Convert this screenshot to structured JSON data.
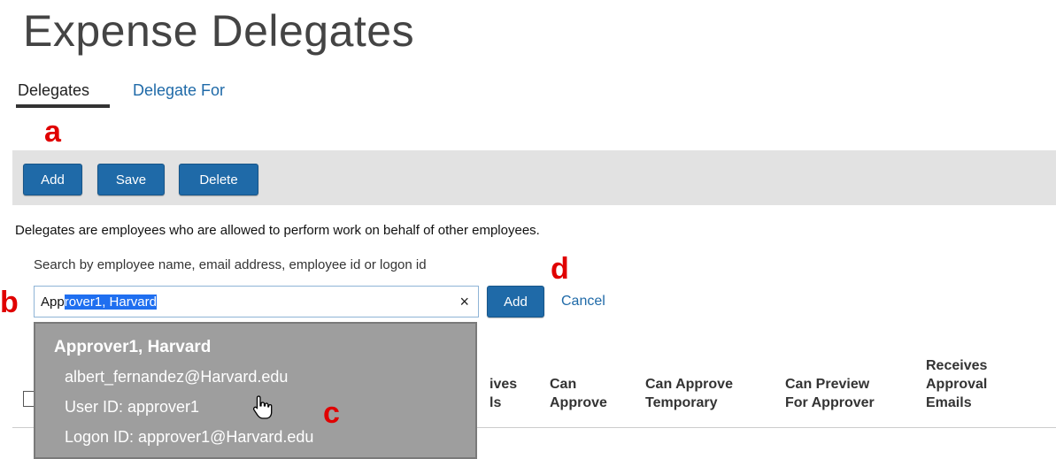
{
  "page": {
    "title": "Expense Delegates"
  },
  "tabs": [
    {
      "label": "Delegates",
      "active": true
    },
    {
      "label": "Delegate For",
      "active": false
    }
  ],
  "callouts": {
    "a": "a",
    "b": "b",
    "c": "c",
    "d": "d"
  },
  "toolbar": {
    "add_label": "Add",
    "save_label": "Save",
    "delete_label": "Delete"
  },
  "info_text": "Delegates are employees who are allowed to perform work on behalf of other employees.",
  "search": {
    "label": "Search by employee name, email address, employee id or logon id",
    "typed": "App",
    "autocomplete": "rover1, Harvard",
    "clear_icon": "×",
    "add_label": "Add",
    "cancel_label": "Cancel"
  },
  "dropdown": {
    "name": "Approver1, Harvard",
    "email": "albert_fernandez@Harvard.edu",
    "user_id": "User ID: approver1",
    "logon_id": "Logon ID: approver1@Harvard.edu"
  },
  "table_headers": {
    "partial_1": "ives",
    "partial_2": "ls",
    "can_approve": [
      "Can",
      "Approve"
    ],
    "can_approve_temporary": [
      "Can Approve",
      "Temporary"
    ],
    "can_preview": [
      "Can Preview",
      "For Approver"
    ],
    "receives_approval": [
      "Receives",
      "Approval",
      "Emails"
    ]
  },
  "colors": {
    "brand": "#1f6aa8",
    "callout": "#e00000",
    "toolbar_bg": "#e2e2e2",
    "dropdown_bg": "#9e9e9e"
  }
}
